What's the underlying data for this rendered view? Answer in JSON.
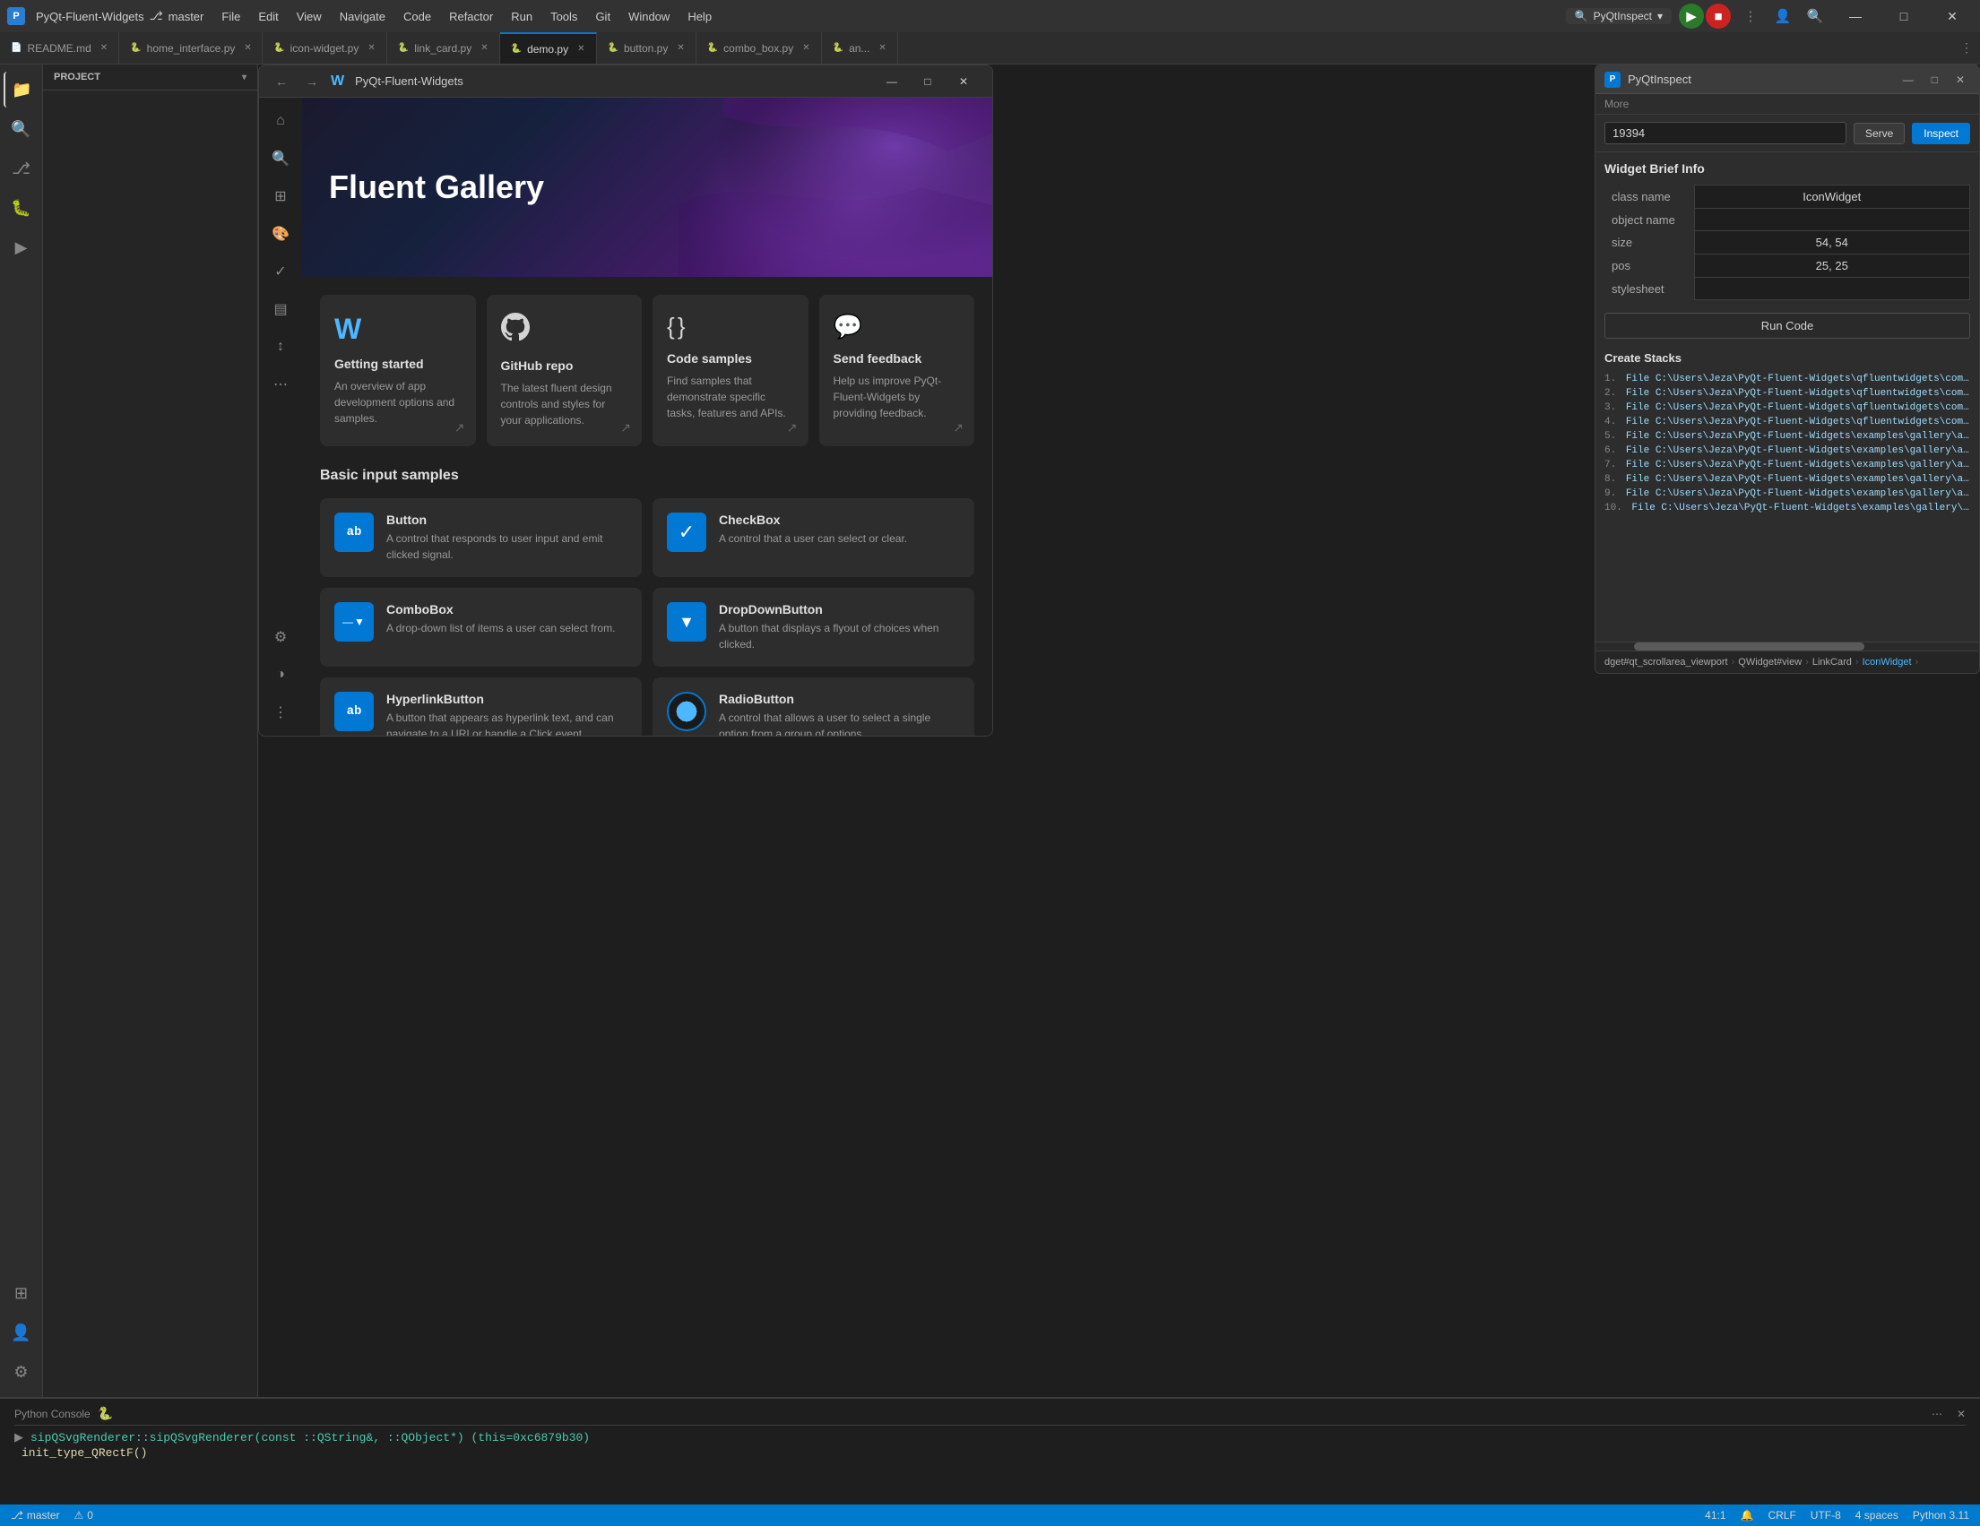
{
  "titlebar": {
    "app_logo": "P",
    "project_name": "PyQt-Fluent-Widgets",
    "branch": "master",
    "menu_items": [
      "File",
      "Edit",
      "View",
      "Navigate",
      "Code",
      "Refactor",
      "Run",
      "Tools",
      "Git",
      "Window",
      "Help"
    ],
    "pyqtinspect_label": "PyQtInspect",
    "run_icon": "▶",
    "stop_icon": "■",
    "profile_icon": "👤",
    "search_icon": "🔍",
    "settings_icon": "⚙",
    "minimize": "—",
    "maximize": "□",
    "close": "✕"
  },
  "tabs": [
    {
      "label": "README.md",
      "dot_color": "#569cd6",
      "active": false
    },
    {
      "label": "home_interface.py",
      "dot_color": "#f0c040",
      "active": false
    },
    {
      "label": "icon-widget.py",
      "dot_color": "#f0c040",
      "active": false
    },
    {
      "label": "link_card.py",
      "dot_color": "#f0c040",
      "active": false
    },
    {
      "label": "demo.py",
      "dot_color": "#f0c040",
      "active": false
    },
    {
      "label": "button.py",
      "dot_color": "#f0c040",
      "active": false
    },
    {
      "label": "combo_box.py",
      "dot_color": "#f0c040",
      "active": false
    },
    {
      "label": "an...",
      "dot_color": "#f0c040",
      "active": false
    }
  ],
  "toolbar": {
    "project_name": "PyQt-Fluent-Widgets",
    "branch_icon": "⎇",
    "branch_name": "master"
  },
  "fluent_window": {
    "title": "PyQt-Fluent-Widgets",
    "hero_title": "Fluent Gallery",
    "nav_back": "←",
    "nav_forward": "→",
    "cards": [
      {
        "icon": "W",
        "icon_type": "logo",
        "title": "Getting started",
        "desc": "An overview of app development options and samples."
      },
      {
        "icon": "⊙",
        "icon_type": "github",
        "title": "GitHub repo",
        "desc": "The latest fluent design controls and styles for your applications."
      },
      {
        "icon": "{ }",
        "icon_type": "code",
        "title": "Code samples",
        "desc": "Find samples that demonstrate specific tasks, features and APIs."
      },
      {
        "icon": "💬",
        "icon_type": "feedback",
        "title": "Send feedback",
        "desc": "Help us improve PyQt-Fluent-Widgets by providing feedback."
      }
    ],
    "basic_input_title": "Basic input samples",
    "widgets": [
      {
        "name": "Button",
        "desc": "A control that responds to user input and emit clicked signal.",
        "icon_text": "ab",
        "icon_type": "button"
      },
      {
        "name": "CheckBox",
        "desc": "A control that a user can select or clear.",
        "icon_text": "✓",
        "icon_type": "checkbox"
      },
      {
        "name": "ComboBox",
        "desc": "A drop-down list of items a user can select from.",
        "icon_text": "—▼",
        "icon_type": "combo"
      },
      {
        "name": "DropDownButton",
        "desc": "A button that displays a flyout of choices when clicked.",
        "icon_text": "▼",
        "icon_type": "dropdown"
      },
      {
        "name": "HyperlinkButton",
        "desc": "A button that appears as hyperlink text, and can navigate to a URI or handle a Click event.",
        "icon_text": "ab",
        "icon_type": "hyperlink"
      },
      {
        "name": "RadioButton",
        "desc": "A control that allows a user to select a single option from a group of options.",
        "icon_text": "●",
        "icon_type": "radio"
      }
    ]
  },
  "inspect_panel": {
    "title": "PyQtInspect",
    "logo": "P",
    "more_label": "More",
    "port_value": "19394",
    "serve_label": "Serve",
    "inspect_label": "Inspect",
    "widget_brief_title": "Widget Brief Info",
    "fields": [
      {
        "key": "class name",
        "value": "IconWidget"
      },
      {
        "key": "object name",
        "value": ""
      },
      {
        "key": "size",
        "value": "54, 54"
      },
      {
        "key": "pos",
        "value": "25, 25"
      },
      {
        "key": "stylesheet",
        "value": ""
      }
    ],
    "run_code_label": "Run Code",
    "create_stacks_title": "Create Stacks",
    "stacks": [
      "File C:\\Users\\Jeza\\PyQt-Fluent-Widgets\\qfluentwidgets\\components\\",
      "File C:\\Users\\Jeza\\PyQt-Fluent-Widgets\\qfluentwidgets\\common\\over",
      "File C:\\Users\\Jeza\\PyQt-Fluent-Widgets\\qfluentwidgets\\components\\",
      "File C:\\Users\\Jeza\\PyQt-Fluent-Widgets\\qfluentwidgets\\common\\over",
      "File C:\\Users\\Jeza\\PyQt-Fluent-Widgets\\examples\\gallery\\app\\compc",
      "File C:\\Users\\Jeza\\PyQt-Fluent-Widgets\\examples\\gallery\\app\\compc",
      "File C:\\Users\\Jeza\\PyQt-Fluent-Widgets\\examples\\gallery\\app\\view\\",
      "File C:\\Users\\Jeza\\PyQt-Fluent-Widgets\\examples\\gallery\\app\\view\\",
      "File C:\\Users\\Jeza\\PyQt-Fluent-Widgets\\examples\\gallery\\app\\view\\",
      "File C:\\Users\\Jeza\\PyQt-Fluent-Widgets\\examples\\gallery\\demo.py,"
    ],
    "breadcrumb": [
      "dget#qt_scrollarea_viewport",
      "QWidget#view",
      "LinkCard",
      "IconWidget"
    ]
  },
  "bottom_panel": {
    "line1": "sipQSvgRenderer::sipQSvgRenderer(const ::QString&, ::QObject*) (this=0xc6879b30)",
    "line2": "init_type_QRectF()"
  },
  "status_bar": {
    "position": "41:1",
    "encoding": "CRLF",
    "charset": "UTF-8",
    "indent": "4 spaces",
    "python_version": "Python 3.11",
    "warnings_icon": "⚠",
    "git_icon": "⎇",
    "notifications": "🔔"
  },
  "activity_icons": [
    "≡",
    "🔍",
    "⎇",
    "🐛",
    "▶",
    "⊞"
  ],
  "sidebar_title": "Project",
  "console_label": "Python Console",
  "console_icon": "🐍"
}
